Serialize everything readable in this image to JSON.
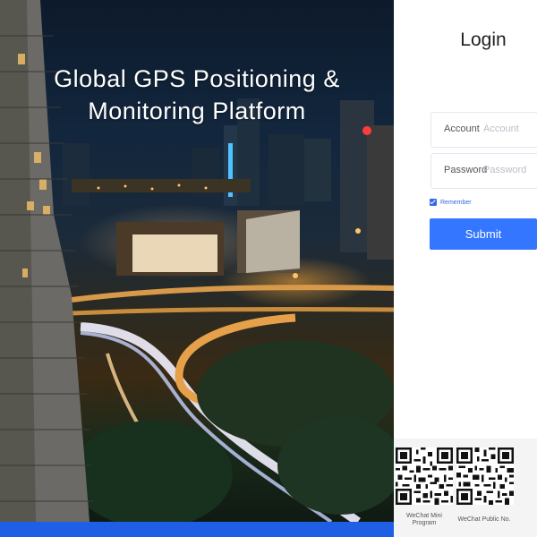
{
  "hero": {
    "title_line1": "Global GPS Positioning &",
    "title_line2": "Monitoring Platform"
  },
  "login": {
    "title": "Login",
    "account_label": "Account",
    "account_placeholder": "Account",
    "password_label": "Password",
    "password_placeholder": "Password",
    "remember_label": "Remember",
    "remember_checked": true,
    "submit_label": "Submit"
  },
  "qr_codes": {
    "mini_program_caption_line1": "WeChat Mini",
    "mini_program_caption_line2": "Program",
    "public_caption": "WeChat Public No."
  },
  "colors": {
    "accent": "#3476ff",
    "bottom_bar": "#1f5fe6"
  }
}
